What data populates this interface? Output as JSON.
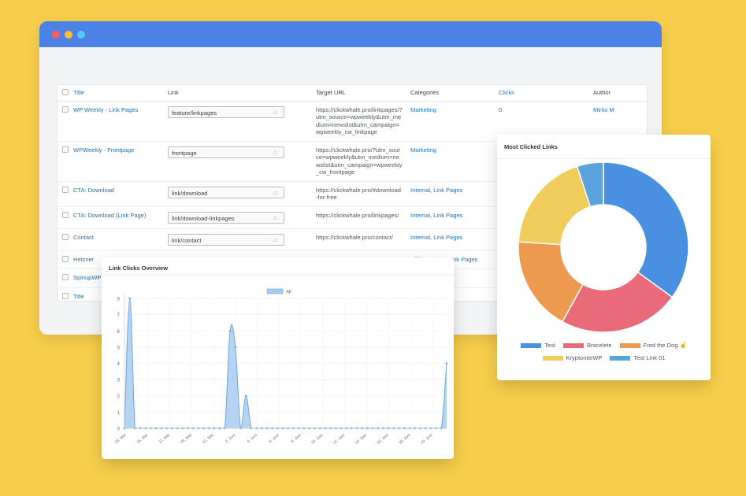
{
  "window": {
    "dots": [
      "#ff5f57",
      "#febc2e",
      "#5ac8fa"
    ],
    "bar_color": "#4c82e6"
  },
  "table": {
    "headers": {
      "title": "Title",
      "link": "Link",
      "target_url": "Target URL",
      "categories": "Categories",
      "clicks": "Clicks",
      "author": "Author"
    },
    "rows": [
      {
        "title": "WP Weekly - Link Pages",
        "link": "feature/linkpages",
        "url": "https://clickwhale.pro/linkpages/?utm_source=wpweekly&utm_medium=newslist&utm_campaign=wpweekly_cw_linkpage",
        "categories": [
          "Marketing"
        ],
        "clicks": "0",
        "author": "Mirko M"
      },
      {
        "title": "WPWeekly - Frontpage",
        "link": "frontpage",
        "url": "https://clickwhale.pro/?utm_source=wpweekly&utm_medium=newslist&utm_campaign=wpweekly_cw_frontpage",
        "categories": [
          "Marketing"
        ],
        "clicks": "",
        "author": ""
      },
      {
        "title": "CTA: Download",
        "link": "link/download",
        "url": "https://clickwhale.pro/#download-for-free",
        "categories": [
          "Internal",
          "Link Pages"
        ],
        "clicks": "",
        "author": ""
      },
      {
        "title": "CTA: Download (Link Page)",
        "link": "link/download-linkpages",
        "url": "https://clickwhale.pro/linkpages/",
        "categories": [
          "Internal",
          "Link Pages"
        ],
        "clicks": "",
        "author": ""
      },
      {
        "title": "Contact",
        "link": "link/contact",
        "url": "https://clickwhale.pro/contact/",
        "categories": [
          "Internal",
          "Link Pages"
        ],
        "clicks": "",
        "author": ""
      },
      {
        "title": "Hetzner",
        "link": "",
        "url": "",
        "categories": [
          "Affiliate Links",
          "Link Pages"
        ],
        "clicks": "",
        "author": ""
      },
      {
        "title": "SpinupWP",
        "link": "",
        "url": "",
        "categories": [
          "Link Pages"
        ],
        "clicks": "",
        "author": ""
      }
    ],
    "footer_title": "Title"
  },
  "line_chart": {
    "title": "Link Clicks Overview",
    "chart_data": {
      "type": "area",
      "series": [
        {
          "name": "All",
          "color": "#7fb3e8",
          "values": [
            0,
            8,
            0,
            0,
            0,
            0,
            0,
            0,
            0,
            0,
            0,
            0,
            0,
            0,
            0,
            0,
            0,
            0,
            0,
            0,
            0,
            0,
            0,
            0,
            0,
            0,
            0,
            0,
            0,
            0,
            0,
            0,
            0,
            0,
            0,
            0,
            0,
            0,
            0,
            0,
            0,
            0,
            0,
            0,
            0,
            0,
            0,
            0,
            0,
            0,
            0,
            0,
            0,
            0,
            0,
            0,
            0,
            0,
            0,
            0,
            0,
            0,
            0,
            0,
            0,
            0,
            0,
            0,
            0,
            0,
            0,
            0,
            0,
            0,
            0,
            0,
            0,
            0,
            0,
            0,
            0,
            0,
            0,
            0,
            0,
            0,
            0,
            0,
            0,
            0,
            0,
            0,
            0,
            0,
            0,
            0,
            0,
            0,
            0,
            0,
            0,
            0,
            0,
            0,
            4
          ]
        }
      ],
      "points": [
        [
          0,
          0
        ],
        [
          1,
          8
        ],
        [
          2,
          0
        ],
        [
          3,
          0
        ],
        [
          4,
          0
        ],
        [
          5,
          0
        ],
        [
          6,
          0
        ],
        [
          7,
          0
        ],
        [
          8,
          0
        ],
        [
          9,
          0
        ],
        [
          10,
          0
        ],
        [
          11,
          0
        ],
        [
          12,
          0
        ],
        [
          13,
          0
        ],
        [
          14,
          0
        ],
        [
          15,
          0
        ],
        [
          16,
          0
        ],
        [
          17,
          0
        ],
        [
          18,
          0
        ],
        [
          19,
          0
        ],
        [
          20,
          6
        ],
        [
          21,
          5
        ],
        [
          22,
          0
        ],
        [
          23,
          2
        ],
        [
          24,
          0
        ],
        [
          25,
          0
        ],
        [
          26,
          0
        ],
        [
          27,
          0
        ],
        [
          28,
          0
        ],
        [
          29,
          0
        ],
        [
          30,
          0
        ],
        [
          31,
          0
        ],
        [
          32,
          0
        ],
        [
          33,
          0
        ],
        [
          34,
          0
        ],
        [
          35,
          0
        ],
        [
          36,
          0
        ],
        [
          37,
          0
        ],
        [
          38,
          0
        ],
        [
          39,
          0
        ],
        [
          40,
          0
        ],
        [
          41,
          0
        ],
        [
          42,
          0
        ],
        [
          43,
          0
        ],
        [
          44,
          0
        ],
        [
          45,
          0
        ],
        [
          46,
          0
        ],
        [
          47,
          0
        ],
        [
          48,
          0
        ],
        [
          49,
          0
        ],
        [
          50,
          0
        ],
        [
          51,
          0
        ],
        [
          52,
          0
        ],
        [
          53,
          0
        ],
        [
          54,
          0
        ],
        [
          55,
          0
        ],
        [
          56,
          0
        ],
        [
          57,
          0
        ],
        [
          58,
          0
        ],
        [
          59,
          0
        ],
        [
          60,
          0
        ],
        [
          61,
          4
        ]
      ],
      "x_tick_labels": [
        "23. Mai",
        "25. Mai",
        "27. Mai",
        "29. Mai",
        "31. Mai",
        "2. Juni",
        "4. Juni",
        "6. Juni",
        "8. Juni",
        "10. Juni",
        "12. Juni",
        "14. Juni",
        "16. Juni",
        "18. Juni",
        "20. Juni"
      ],
      "y_ticks": [
        0,
        1,
        2,
        3,
        4,
        5,
        6,
        7,
        8
      ],
      "ylim": [
        0,
        8
      ],
      "legend": "top-center",
      "grid": true
    }
  },
  "donut_chart": {
    "title": "Most Clicked Links",
    "chart_data": {
      "type": "pie",
      "donut": true,
      "categories": [
        "Test",
        "Bracelete",
        "Fred the Dog ☝",
        "KryptoniteWP",
        "Test Link 01"
      ],
      "values": [
        35,
        23,
        18,
        19,
        5
      ],
      "colors": [
        "#4a90e2",
        "#e96b7a",
        "#ec9a50",
        "#f0cc5c",
        "#5aa4dd"
      ],
      "legend": "bottom"
    }
  }
}
